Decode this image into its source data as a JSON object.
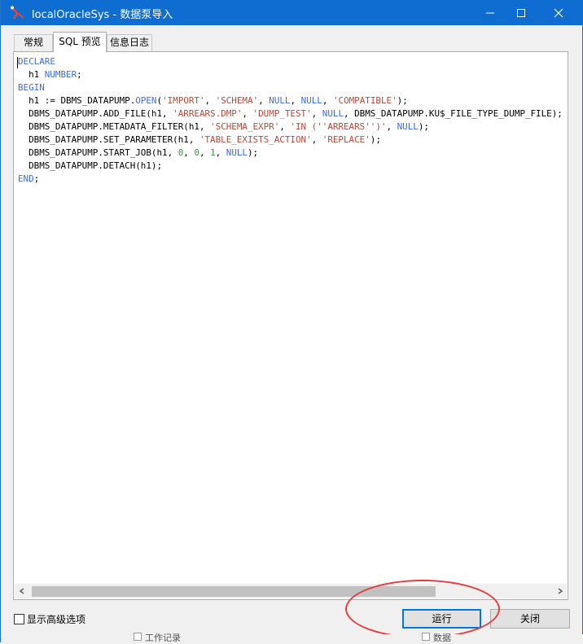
{
  "window": {
    "app_name": "localOracleSys",
    "title_suffix": " - 数据泵导入"
  },
  "tabs": [
    {
      "label": "常规",
      "active": false
    },
    {
      "label": "SQL 预览",
      "active": true
    },
    {
      "label": "信息日志",
      "active": false
    }
  ],
  "code_lines": [
    [
      [
        "kw",
        "DECLARE"
      ]
    ],
    [
      [
        "plain",
        "  h1 "
      ],
      [
        "kw",
        "NUMBER"
      ],
      [
        "plain",
        ";"
      ]
    ],
    [
      [
        "kw",
        "BEGIN"
      ]
    ],
    [
      [
        "plain",
        "  h1 := DBMS_DATAPUMP."
      ],
      [
        "kw",
        "OPEN"
      ],
      [
        "plain",
        "("
      ],
      [
        "str",
        "'IMPORT'"
      ],
      [
        "plain",
        ", "
      ],
      [
        "str",
        "'SCHEMA'"
      ],
      [
        "plain",
        ", "
      ],
      [
        "kw",
        "NULL"
      ],
      [
        "plain",
        ", "
      ],
      [
        "kw",
        "NULL"
      ],
      [
        "plain",
        ", "
      ],
      [
        "str",
        "'COMPATIBLE'"
      ],
      [
        "plain",
        ");"
      ]
    ],
    [
      [
        "plain",
        "  DBMS_DATAPUMP.ADD_FILE(h1, "
      ],
      [
        "str",
        "'ARREARS.DMP'"
      ],
      [
        "plain",
        ", "
      ],
      [
        "str",
        "'DUMP_TEST'"
      ],
      [
        "plain",
        ", "
      ],
      [
        "kw",
        "NULL"
      ],
      [
        "plain",
        ", DBMS_DATAPUMP.KU$_FILE_TYPE_DUMP_FILE);"
      ]
    ],
    [
      [
        "plain",
        "  DBMS_DATAPUMP.METADATA_FILTER(h1, "
      ],
      [
        "str",
        "'SCHEMA_EXPR'"
      ],
      [
        "plain",
        ", "
      ],
      [
        "str",
        "'IN (''ARREARS'')'"
      ],
      [
        "plain",
        ", "
      ],
      [
        "kw",
        "NULL"
      ],
      [
        "plain",
        ");"
      ]
    ],
    [
      [
        "plain",
        "  DBMS_DATAPUMP.SET_PARAMETER(h1, "
      ],
      [
        "str",
        "'TABLE_EXISTS_ACTION'"
      ],
      [
        "plain",
        ", "
      ],
      [
        "str",
        "'REPLACE'"
      ],
      [
        "plain",
        ");"
      ]
    ],
    [
      [
        "plain",
        "  DBMS_DATAPUMP.START_JOB(h1, "
      ],
      [
        "num",
        "0"
      ],
      [
        "plain",
        ", "
      ],
      [
        "num",
        "0"
      ],
      [
        "plain",
        ", "
      ],
      [
        "num",
        "1"
      ],
      [
        "plain",
        ", "
      ],
      [
        "kw",
        "NULL"
      ],
      [
        "plain",
        ");"
      ]
    ],
    [
      [
        "plain",
        "  DBMS_DATAPUMP.DETACH(h1);"
      ]
    ],
    [
      [
        "kw",
        "END"
      ],
      [
        "plain",
        ";"
      ]
    ]
  ],
  "options": {
    "show_advanced_label": "显示高级选项",
    "show_advanced_checked": false
  },
  "buttons": {
    "run_label": "运行",
    "close_label": "关闭"
  },
  "horizontal_scroll_fraction": 0.78,
  "background_fragments": [
    "工作记录",
    "数据"
  ],
  "colors": {
    "titlebar": "#0f6cd1",
    "keyword": "#3b6fd6",
    "string": "#b24b3a",
    "number": "#2f9a39",
    "annotation": "#e53c3c"
  }
}
